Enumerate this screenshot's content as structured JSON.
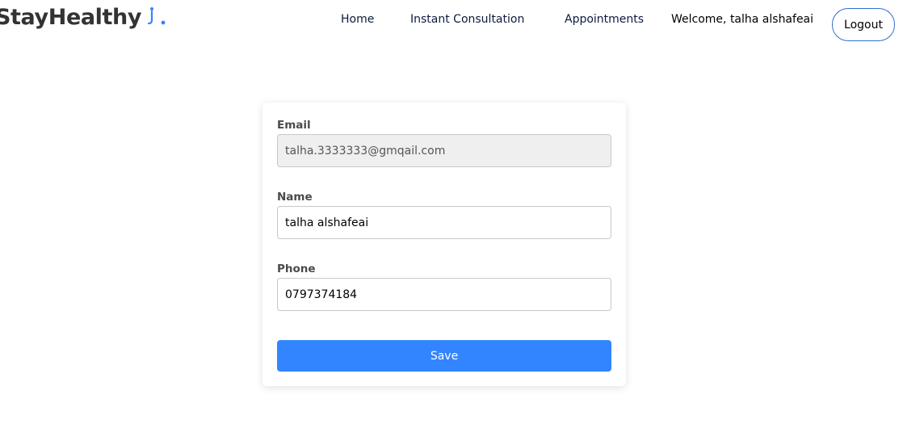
{
  "navbar": {
    "brand": "StayHealthy",
    "links": [
      {
        "label": "Home"
      },
      {
        "label": "Instant Consultation"
      },
      {
        "label": "Appointments"
      }
    ],
    "welcome": "Welcome, talha alshafeai",
    "logout_label": "Logout"
  },
  "profile_form": {
    "email": {
      "label": "Email",
      "value": "talha.3333333@gmqail.com"
    },
    "name": {
      "label": "Name",
      "value": "talha alshafeai"
    },
    "phone": {
      "label": "Phone",
      "value": "0797374184"
    },
    "save_label": "Save"
  },
  "colors": {
    "accent": "#3385ff",
    "brand_icon": "#3385ff"
  },
  "icons": {
    "brand_icon": "stethoscope-icon"
  }
}
